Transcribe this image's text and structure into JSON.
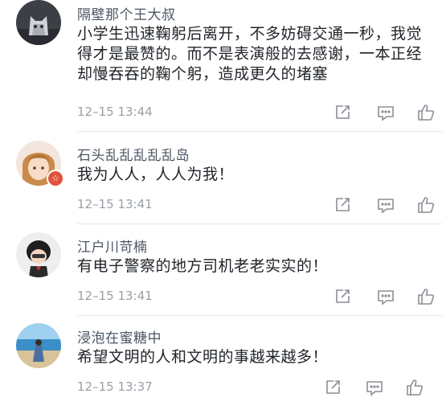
{
  "comments": [
    {
      "username": "隔壁那个王大叔",
      "lines": [
        "小学生迅速鞠躬后离开，不多妨碍交通一秒，我觉",
        "得才是最赞的。而不是表演般的去感谢，一本正经",
        "却慢吞吞的鞠个躬，造成更久的堵塞"
      ],
      "timestamp": "12–15 13:44",
      "avatar_icon": "cat-avatar-icon"
    },
    {
      "username": "石头乱乱乱乱乱岛",
      "lines": [
        "我为人人，人人为我！"
      ],
      "timestamp": "12–15 13:41",
      "avatar_icon": "anime-girl-avatar-icon",
      "badge": "☆"
    },
    {
      "username": "江户川苛楠",
      "lines": [
        "有电子警察的地方司机老老实实的！"
      ],
      "timestamp": "12–15 13:41",
      "avatar_icon": "cartoon-boy-avatar-icon"
    },
    {
      "username": "浸泡在蜜糖中",
      "lines": [
        "希望文明的人和文明的事越来越多！"
      ],
      "timestamp": "12–15 13:37",
      "avatar_icon": "beach-photo-avatar-icon"
    }
  ],
  "icons": {
    "share": "share-icon",
    "reply": "reply-icon",
    "like": "thumbs-up-icon"
  },
  "colors": {
    "text": "#1f2328",
    "username": "#4b5563",
    "timestamp": "#9aa0a6",
    "icon": "#8a8f96",
    "badge": "#e2533c"
  }
}
